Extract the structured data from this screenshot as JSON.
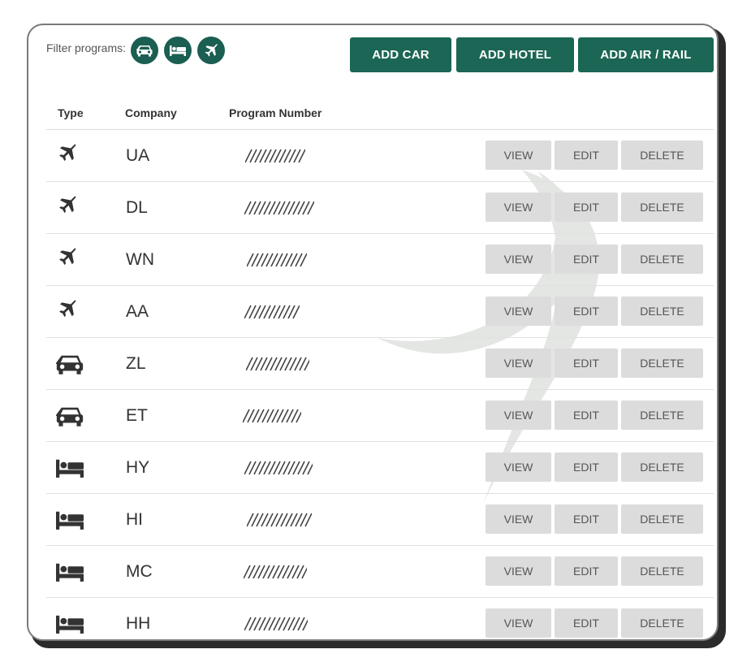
{
  "filter": {
    "label": "Filter programs:",
    "chips": [
      {
        "icon": "car-icon"
      },
      {
        "icon": "bed-icon"
      },
      {
        "icon": "plane-icon"
      }
    ]
  },
  "actions": {
    "add_car": "ADD CAR",
    "add_hotel": "ADD HOTEL",
    "add_air_rail": "ADD AIR / RAIL"
  },
  "table": {
    "headers": {
      "type": "Type",
      "company": "Company",
      "program_number": "Program Number"
    },
    "row_actions": {
      "view": "VIEW",
      "edit": "EDIT",
      "delete": "DELETE"
    },
    "rows": [
      {
        "type": "plane-icon",
        "company": "UA"
      },
      {
        "type": "plane-icon",
        "company": "DL"
      },
      {
        "type": "plane-icon",
        "company": "WN"
      },
      {
        "type": "plane-icon",
        "company": "AA"
      },
      {
        "type": "car-icon",
        "company": "ZL"
      },
      {
        "type": "car-icon",
        "company": "ET"
      },
      {
        "type": "bed-icon",
        "company": "HY"
      },
      {
        "type": "bed-icon",
        "company": "HI"
      },
      {
        "type": "bed-icon",
        "company": "MC"
      },
      {
        "type": "bed-icon",
        "company": "HH"
      }
    ]
  },
  "colors": {
    "accent": "#1b6654",
    "button_gray": "#dcdcdc",
    "icon": "#333333"
  }
}
